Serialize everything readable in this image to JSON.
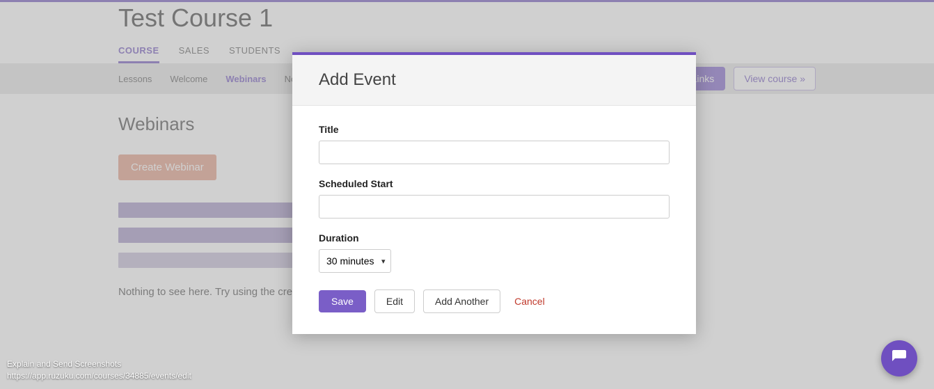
{
  "page": {
    "title": "Test Course 1"
  },
  "primaryTabs": {
    "course": "COURSE",
    "sales": "SALES",
    "students": "STUDENTS"
  },
  "subTabs": {
    "lessons": "Lessons",
    "welcome": "Welcome",
    "webinars": "Webinars",
    "notif": "Notif"
  },
  "subNavRight": {
    "links": "Links",
    "viewCourse": "View course »"
  },
  "section": {
    "heading": "Webinars",
    "createBtn": "Create Webinar",
    "emptyMsg": "Nothing to see here. Try using the create b"
  },
  "modal": {
    "title": "Add Event",
    "labels": {
      "title": "Title",
      "scheduledStart": "Scheduled Start",
      "duration": "Duration"
    },
    "values": {
      "title": "",
      "scheduledStart": "",
      "duration": "30 minutes"
    },
    "actions": {
      "save": "Save",
      "edit": "Edit",
      "addAnother": "Add Another",
      "cancel": "Cancel"
    }
  },
  "footer": {
    "line1": "Explain and Send Screenshots",
    "line2": "https://app.ruzuku.com/courses/34885/events/edit"
  }
}
